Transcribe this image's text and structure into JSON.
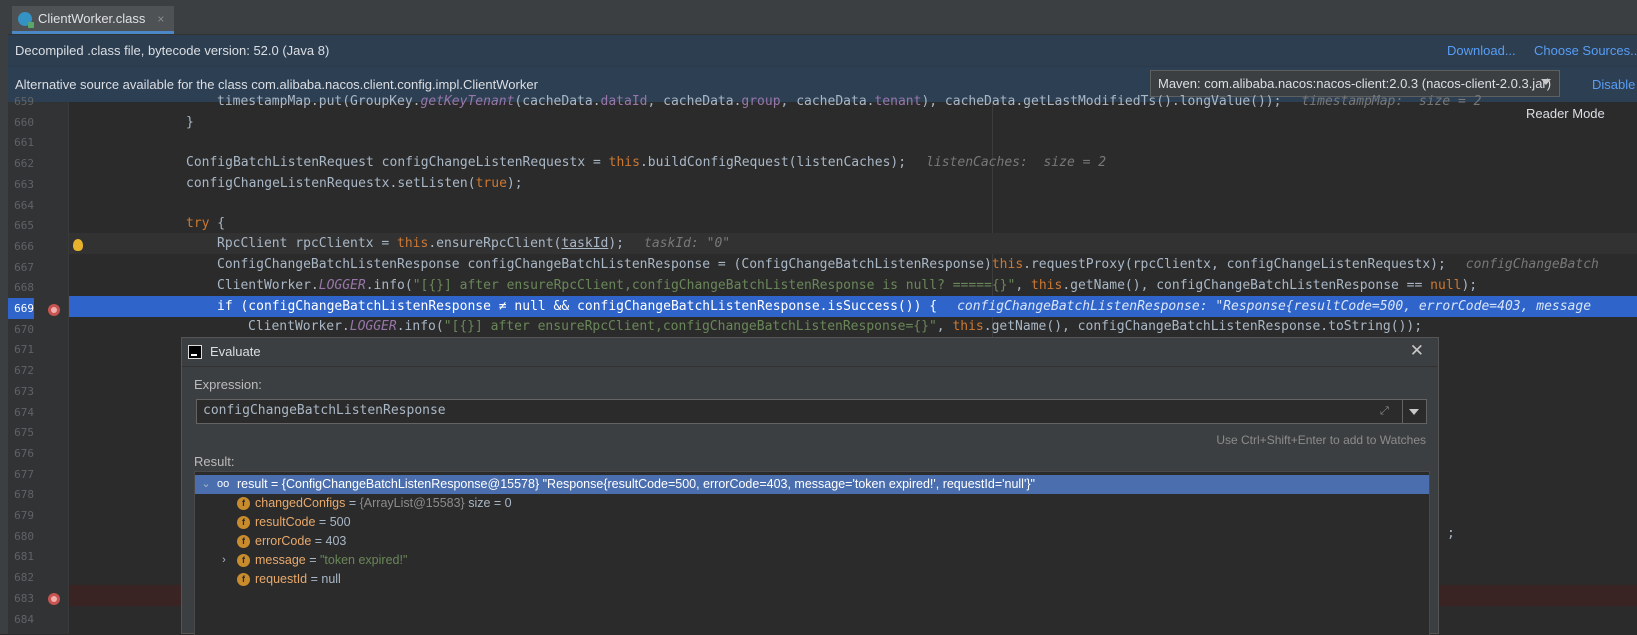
{
  "tab": {
    "title": "ClientWorker.class",
    "close": "×"
  },
  "banner1": {
    "text": "Decompiled .class file, bytecode version: 52.0 (Java 8)",
    "download": "Download...",
    "choose_sources": "Choose Sources..."
  },
  "banner2": {
    "text": "Alternative source available for the class com.alibaba.nacos.client.config.impl.ClientWorker",
    "maven_select": "Maven: com.alibaba.nacos:nacos-client:2.0.3 (nacos-client-2.0.3.jar)",
    "disable": "Disable"
  },
  "reader_mode": "Reader Mode",
  "line_numbers": [
    "659",
    "660",
    "661",
    "662",
    "663",
    "664",
    "665",
    "666",
    "667",
    "668",
    "669",
    "670",
    "671",
    "672",
    "673",
    "674",
    "675",
    "676",
    "677",
    "678",
    "679",
    "680",
    "681",
    "682",
    "683",
    "684"
  ],
  "code": {
    "l659a": "timestampMap.put(GroupKey.",
    "l659b": "getKeyTenant",
    "l659c": "(cacheData.",
    "l659d": "dataId",
    "l659e": ", cacheData.",
    "l659f": "group",
    "l659g": ", cacheData.",
    "l659h": "tenant",
    "l659i": "), cacheData.getLastModifiedTs().longValue());",
    "l659hint": "timestampMap:  size = 2",
    "l660": "}",
    "l662": "ConfigBatchListenRequest configChangeListenRequestx = ",
    "l662b": "this",
    "l662c": ".buildConfigRequest(listenCaches);",
    "l662hint": "listenCaches:  size = 2",
    "l663a": "configChangeListenRequestx.setListen(",
    "l663b": "true",
    "l663c": ");",
    "l665a": "try",
    "l665b": " {",
    "l666a": "RpcClient rpcClientx = ",
    "l666b": "this",
    "l666c": ".ensureRpcClient(",
    "l666d": "taskId",
    "l666e": ");",
    "l666hint": "taskId: \"0\"",
    "l667a": "ConfigChangeBatchListenResponse configChangeBatchListenResponse = (ConfigChangeBatchListenResponse)",
    "l667b": "this",
    "l667c": ".requestProxy(rpcClientx, configChangeListenRequestx);",
    "l667hint": "configChangeBatch",
    "l668a": "ClientWorker.",
    "l668b": "LOGGER",
    "l668c": ".info(",
    "l668d": "\"[{}] after ensureRpcClient,configChangeBatchListenResponse is null? ====={}\"",
    "l668e": ", ",
    "l668f": "this",
    "l668g": ".getName(), configChangeBatchListenResponse == ",
    "l668h": "null",
    "l668i": ");",
    "l669a": "if",
    "l669b": " (configChangeBatchListenResponse ≠ ",
    "l669c": "null",
    "l669d": " && configChangeBatchListenResponse.isSuccess()) {",
    "l669hint": "configChangeBatchListenResponse: \"Response{resultCode=500, errorCode=403, message",
    "l670a": "ClientWorker.",
    "l670b": "LOGGER",
    "l670c": ".info(",
    "l670d": "\"[{}] after ensureRpcClient,configChangeBatchListenResponse={}\"",
    "l670e": ", ",
    "l670f": "this",
    "l670g": ".getName(), configChangeBatchListenResponse.toString());",
    "l680": ";"
  },
  "dialog": {
    "title": "Evaluate",
    "close": "✕",
    "expression_label": "Expression:",
    "expression": "configChangeBatchListenResponse",
    "hint": "Use Ctrl+Shift+Enter to add to Watches",
    "result_label": "Result:",
    "result_row": "result = {ConfigChangeBatchListenResponse@15578} \"Response{resultCode=500, errorCode=403, message='token expired!', requestId='null'}\"",
    "fields": [
      {
        "name": "changedConfigs",
        "eq": " = ",
        "ref": "{ArrayList@15583}",
        "value": "  size = 0",
        "expandable": false
      },
      {
        "name": "resultCode",
        "eq": " = ",
        "ref": "",
        "value": "500",
        "expandable": false
      },
      {
        "name": "errorCode",
        "eq": " = ",
        "ref": "",
        "value": "403",
        "expandable": false
      },
      {
        "name": "message",
        "eq": " = ",
        "ref": "",
        "value": "\"token expired!\"",
        "expandable": true
      },
      {
        "name": "requestId",
        "eq": " = ",
        "ref": "",
        "value": "null",
        "expandable": false
      }
    ],
    "field_icon": "f"
  },
  "colors": {
    "selection": "#2f65ca",
    "tree_selection": "#4b6eaf",
    "breakpoint": "#c75450",
    "keyword": "#cc7832",
    "string": "#6a8759"
  }
}
